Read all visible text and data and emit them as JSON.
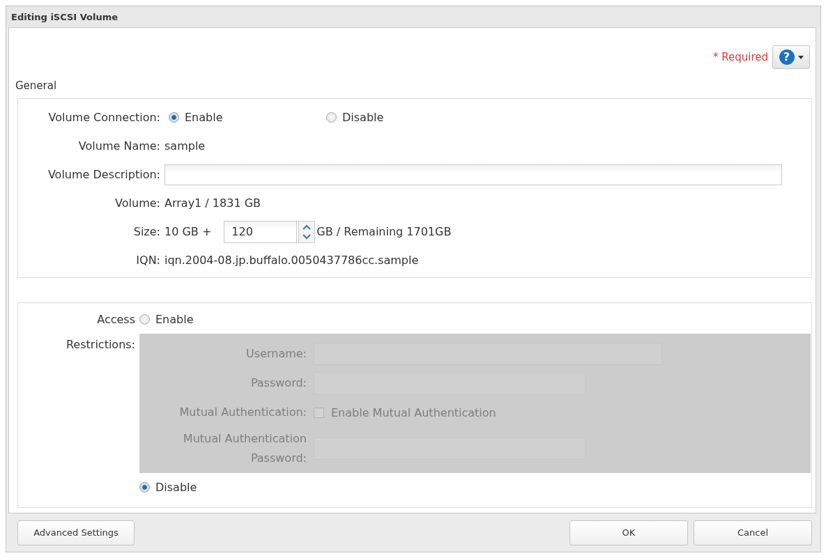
{
  "window": {
    "title": "Editing iSCSI Volume"
  },
  "header": {
    "required_note": "* Required",
    "help_button": {
      "icon_text": "?"
    }
  },
  "general": {
    "title": "General",
    "fields": [
      {
        "kind": "radio",
        "label": "Volume Connection:",
        "options": [
          {
            "label": "Enable",
            "selected": true
          },
          {
            "label": "Disable",
            "selected": false
          }
        ]
      },
      {
        "kind": "text",
        "label": "Volume Name:",
        "value": "sample"
      },
      {
        "kind": "input",
        "label": "Volume Description:"
      },
      {
        "kind": "text",
        "label": "Volume:",
        "value": "Array1 / 1831 GB"
      },
      {
        "kind": "spinner",
        "label": "Size:",
        "prefix": "10 GB +",
        "value": "120",
        "suffix": "GB / Remaining 1701GB"
      },
      {
        "kind": "text",
        "label": "IQN:",
        "value": "iqn.2004-08.jp.buffalo.0050437786cc.sample"
      }
    ]
  },
  "access_restrictions": {
    "label": "Access Restrictions:",
    "options": [
      {
        "label": "Enable",
        "selected": false
      },
      {
        "label": "Disable",
        "selected": true
      }
    ],
    "settings": {
      "disabled": true,
      "fields": [
        {
          "kind": "input",
          "label": "Username:"
        },
        {
          "kind": "input",
          "label": "Password:"
        },
        {
          "kind": "checkbox",
          "label": "Mutual Authentication:",
          "option": "Enable Mutual Authentication",
          "checked": false
        },
        {
          "kind": "input",
          "label": "Mutual Authentication Password:"
        }
      ]
    }
  },
  "footer": {
    "left_buttons": [
      "Advanced Settings"
    ],
    "right_buttons": [
      "OK",
      "Cancel"
    ]
  }
}
